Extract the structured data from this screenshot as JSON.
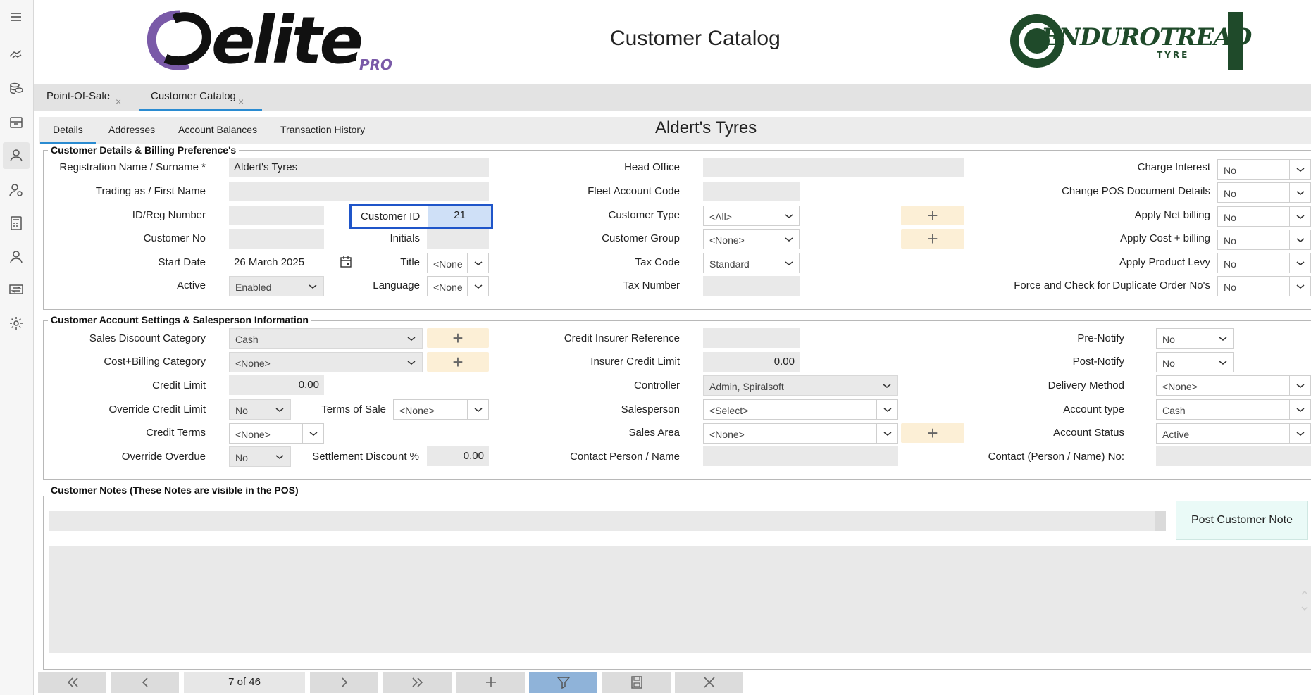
{
  "header": {
    "title": "Customer Catalog",
    "logo_left": "elite",
    "logo_left_sub": "PRO",
    "logo_right": "ENDUROTREAD",
    "logo_right_sub": "TYRE"
  },
  "doc_tabs": [
    {
      "label": "Point-Of-Sale",
      "close": "×"
    },
    {
      "label": "Customer Catalog",
      "close": "×"
    }
  ],
  "inner_tabs": [
    "Details",
    "Addresses",
    "Account Balances",
    "Transaction History"
  ],
  "record_title": "Aldert's Tyres",
  "billing": {
    "title": "Customer Details & Billing Preference's",
    "reg_name_label": "Registration Name / Surname *",
    "reg_name": "Aldert's Tyres",
    "trading_label": "Trading as / First Name",
    "id_reg_label": "ID/Reg Number",
    "customer_id_label": "Customer ID",
    "customer_id": "21",
    "customer_no_label": "Customer No",
    "initials_label": "Initials",
    "start_date_label": "Start Date",
    "start_date": "26 March 2025",
    "title_label": "Title",
    "title_value": "<None",
    "active_label": "Active",
    "active_value": "Enabled",
    "language_label": "Language",
    "language_value": "<None",
    "head_office_label": "Head Office",
    "fleet_label": "Fleet Account Code",
    "cust_type_label": "Customer Type",
    "cust_type_value": "<All>",
    "cust_group_label": "Customer Group",
    "cust_group_value": "<None>",
    "tax_code_label": "Tax Code",
    "tax_code_value": "Standard",
    "tax_number_label": "Tax Number",
    "charge_interest_label": "Charge Interest",
    "charge_interest": "No",
    "change_pos_label": "Change POS Document Details",
    "change_pos": "No",
    "apply_net_label": "Apply Net billing",
    "apply_net": "No",
    "apply_cost_label": "Apply Cost + billing",
    "apply_cost": "No",
    "apply_levy_label": "Apply Product Levy",
    "apply_levy": "No",
    "force_check_label": "Force and Check for Duplicate Order No's",
    "force_check": "No"
  },
  "account": {
    "title": "Customer Account Settings & Salesperson Information",
    "sales_disc_label": "Sales Discount Category",
    "sales_disc": "Cash",
    "cost_billing_label": "Cost+Billing Category",
    "cost_billing": "<None>",
    "credit_limit_label": "Credit Limit",
    "credit_limit": "0.00",
    "override_credit_label": "Override Credit Limit",
    "override_credit": "No",
    "terms_label": "Terms of Sale",
    "terms": "<None>",
    "credit_terms_label": "Credit Terms",
    "credit_terms": "<None>",
    "override_overdue_label": "Override Overdue",
    "override_overdue": "No",
    "settlement_label": "Settlement Discount %",
    "settlement": "0.00",
    "insurer_ref_label": "Credit Insurer Reference",
    "insurer_limit_label": "Insurer Credit Limit",
    "insurer_limit": "0.00",
    "controller_label": "Controller",
    "controller": "Admin, Spiralsoft",
    "salesperson_label": "Salesperson",
    "salesperson": "<Select>",
    "sales_area_label": "Sales Area",
    "sales_area": "<None>",
    "contact_label": "Contact Person / Name",
    "pre_notify_label": "Pre-Notify",
    "pre_notify": "No",
    "post_notify_label": "Post-Notify",
    "post_notify": "No",
    "delivery_label": "Delivery Method",
    "delivery": "<None>",
    "acct_type_label": "Account type",
    "acct_type": "Cash",
    "acct_status_label": "Account Status",
    "acct_status": "Active",
    "contact_no_label": "Contact (Person / Name) No:"
  },
  "notes": {
    "title": "Customer Notes (These Notes are visible in the POS)",
    "post_button": "Post Customer Note"
  },
  "nav": {
    "pager": "7 of 46"
  },
  "colors": {
    "accent": "#2a8bd1",
    "highlight_border": "#1f55c9",
    "plus_bg": "#fcefd6",
    "brand_green": "#1f4a2a",
    "brand_purple": "#7a5aa8"
  }
}
